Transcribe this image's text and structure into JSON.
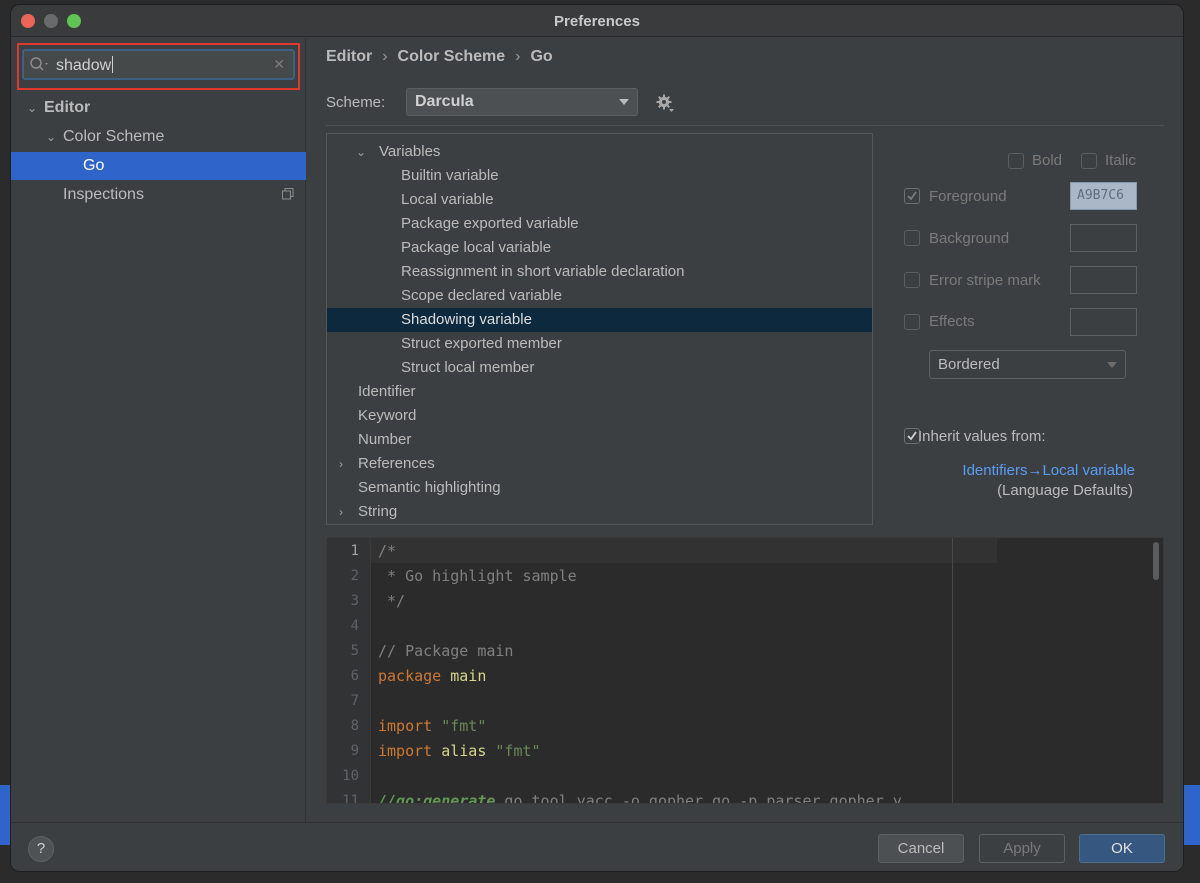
{
  "window": {
    "title": "Preferences"
  },
  "search": {
    "value": "shadow"
  },
  "sidebar": {
    "items": [
      {
        "label": "Editor"
      },
      {
        "label": "Color Scheme"
      },
      {
        "label": "Go"
      },
      {
        "label": "Inspections"
      }
    ]
  },
  "breadcrumb": [
    "Editor",
    "Color Scheme",
    "Go"
  ],
  "scheme": {
    "label": "Scheme:",
    "value": "Darcula"
  },
  "attributes_tree": [
    {
      "label": "Variables",
      "expanded": true
    },
    {
      "label": "Builtin variable"
    },
    {
      "label": "Local variable"
    },
    {
      "label": "Package exported variable"
    },
    {
      "label": "Package local variable"
    },
    {
      "label": "Reassignment in short variable declaration"
    },
    {
      "label": "Scope declared variable"
    },
    {
      "label": "Shadowing variable",
      "selected": true
    },
    {
      "label": "Struct exported member"
    },
    {
      "label": "Struct local member"
    },
    {
      "label": "Identifier"
    },
    {
      "label": "Keyword"
    },
    {
      "label": "Number"
    },
    {
      "label": "References",
      "expandable": true
    },
    {
      "label": "Semantic highlighting"
    },
    {
      "label": "String",
      "expandable": true
    }
  ],
  "options": {
    "bold": "Bold",
    "italic": "Italic",
    "foreground": "Foreground",
    "foreground_value": "A9B7C6",
    "background": "Background",
    "error_stripe": "Error stripe mark",
    "effects": "Effects",
    "effect_type": "Bordered",
    "inherit_label": "Inherit values from:",
    "inherit_link": "Identifiers→Local variable",
    "inherit_source": "(Language Defaults)"
  },
  "preview": {
    "line_numbers": [
      "1",
      "2",
      "3",
      "4",
      "5",
      "6",
      "7",
      "8",
      "9",
      "10",
      "11"
    ],
    "lines": [
      "/*",
      " * Go highlight sample",
      " */",
      "",
      "// Package main",
      "package main",
      "",
      "import \"fmt\"",
      "import alias \"fmt\"",
      "",
      "//go:generate go tool yacc -o gopher.go -p parser gopher.y"
    ]
  },
  "footer": {
    "help": "?",
    "cancel": "Cancel",
    "apply": "Apply",
    "ok": "OK"
  },
  "colors": {
    "accent": "#2f65ca",
    "selection": "#0d293e",
    "link": "#589df6",
    "search_highlight_border": "#e0382c"
  }
}
